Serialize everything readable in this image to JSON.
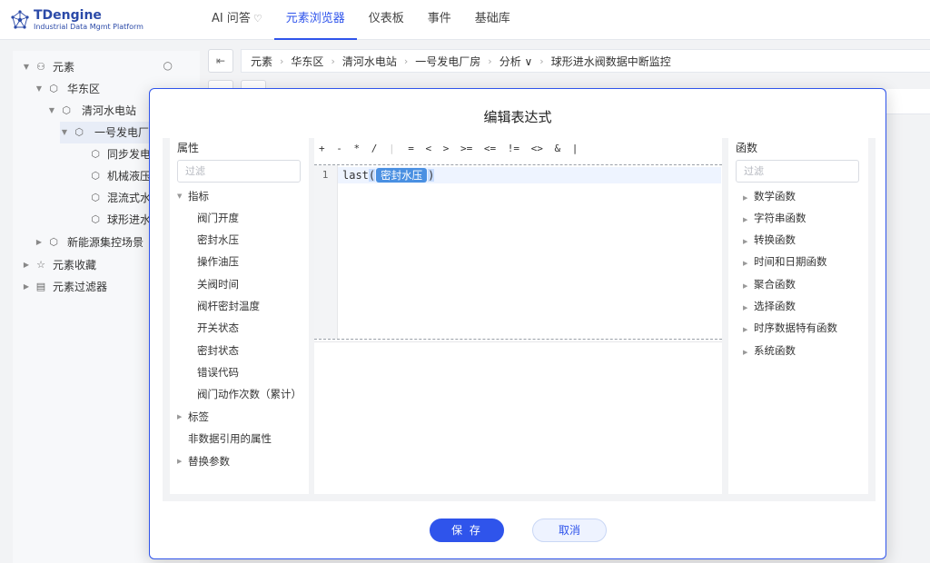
{
  "app": {
    "logo_title": "TDengine",
    "logo_subtitle": "Industrial Data Mgmt Platform",
    "brand_color": "#2b4aa8",
    "accent_color": "#2f54eb"
  },
  "nav": {
    "items": [
      {
        "label": "AI 问答",
        "icon": "lightbulb-icon"
      },
      {
        "label": "元素浏览器",
        "active": true
      },
      {
        "label": "仪表板"
      },
      {
        "label": "事件"
      },
      {
        "label": "基础库"
      }
    ]
  },
  "tree": {
    "search_icon": "search-icon",
    "nodes": [
      {
        "label": "元素",
        "icon": "element-root-icon",
        "expanded": true
      },
      {
        "label": "华东区",
        "icon": "cube-icon",
        "expanded": true
      },
      {
        "label": "清河水电站",
        "icon": "cube-icon",
        "expanded": true
      },
      {
        "label": "一号发电厂房",
        "icon": "cube-icon",
        "expanded": true,
        "selected": true
      },
      {
        "label": "同步发电机",
        "icon": "cube-icon"
      },
      {
        "label": "机械液压",
        "icon": "cube-icon"
      },
      {
        "label": "混流式水",
        "icon": "cube-icon"
      },
      {
        "label": "球形进水",
        "icon": "cube-icon"
      },
      {
        "label": "新能源集控场景",
        "icon": "cube-icon",
        "expanded": false
      },
      {
        "label": "元素收藏",
        "icon": "favorite-icon",
        "expanded": false
      },
      {
        "label": "元素过滤器",
        "icon": "filter-doc-icon",
        "expanded": false
      }
    ]
  },
  "breadcrumb": {
    "items": [
      "元素",
      "华东区",
      "清河水电站",
      "一号发电厂房",
      "分析 ∨",
      "球形进水阀数据中断监控"
    ]
  },
  "modal": {
    "title": "编辑表达式",
    "attributes": {
      "title": "属性",
      "filter_placeholder": "过滤",
      "groups": [
        {
          "label": "指标",
          "expanded": true,
          "children": [
            "阀门开度",
            "密封水压",
            "操作油压",
            "关阀时间",
            "阀杆密封温度",
            "开关状态",
            "密封状态",
            "错误代码",
            "阀门动作次数（累计）"
          ]
        },
        {
          "label": "标签",
          "expanded": false
        },
        {
          "label": "非数据引用的属性",
          "plain": true
        },
        {
          "label": "替换参数",
          "expanded": false
        }
      ]
    },
    "operators": [
      "+",
      "-",
      "*",
      "/",
      "=",
      "<",
      ">",
      ">=",
      "<=",
      "!=",
      "<>",
      "&",
      "|"
    ],
    "editor": {
      "line_number": "1",
      "code_prefix": "last",
      "open_paren": "(",
      "token": "密封水压",
      "close_paren": ")"
    },
    "functions": {
      "title": "函数",
      "filter_placeholder": "过滤",
      "items": [
        "数学函数",
        "字符串函数",
        "转换函数",
        "时间和日期函数",
        "聚合函数",
        "选择函数",
        "时序数据特有函数",
        "系统函数"
      ]
    },
    "save_label": "保 存",
    "cancel_label": "取消"
  }
}
